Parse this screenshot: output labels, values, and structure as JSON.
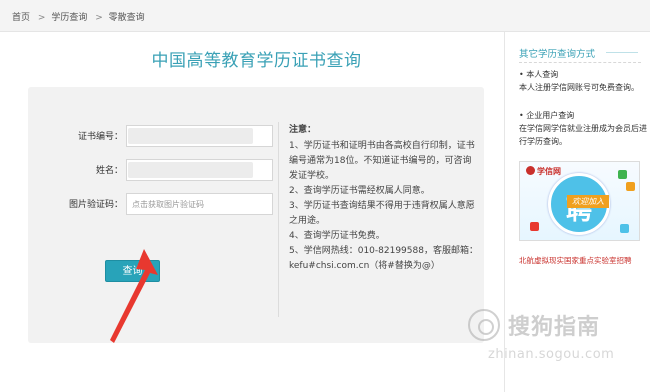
{
  "breadcrumb": {
    "items": [
      "首页",
      "学历查询",
      "零散查询"
    ],
    "sep": ">"
  },
  "main": {
    "title": "中国高等教育学历证书查询",
    "form": {
      "cert_label": "证书编号：",
      "name_label": "姓名：",
      "captcha_label": "图片验证码：",
      "captcha_placeholder": "点击获取图片验证码",
      "submit_label": "查询"
    },
    "notes": {
      "title": "注意：",
      "items": [
        "1、学历证书和证明书由各高校自行印制，证书编号通常为18位。不知道证书编号的，可咨询发证学校。",
        "2、查询学历证书需经权属人同意。",
        "3、学历证书查询结果不得用于违背权属人意愿之用途。",
        "4、查询学历证书免费。",
        "5、学信网热线：010-82199588，客服邮箱：kefu#chsi.com.cn（将#替换为@）"
      ]
    }
  },
  "sidebar": {
    "title": "其它学历查询方式",
    "personal": {
      "head": "• 本人查询",
      "desc": "本人注册学信网账号可免费查询。"
    },
    "enterprise": {
      "head": "• 企业用户查询",
      "desc": "在学信网学信就业注册成为会员后进行学历查询。"
    },
    "ad": {
      "logo": "学信网",
      "big": "聘",
      "ribbon": "欢迎加入"
    },
    "link": "北航虚拟现实国家重点实验室招聘"
  },
  "watermark": {
    "text": "搜狗指南",
    "url": "zhinan.sogou.com"
  },
  "colors": {
    "accent": "#28a3b9",
    "title": "#3aa1b6",
    "panel": "#f2f2f2",
    "arrow": "#e8382f",
    "link": "#c9302c"
  }
}
